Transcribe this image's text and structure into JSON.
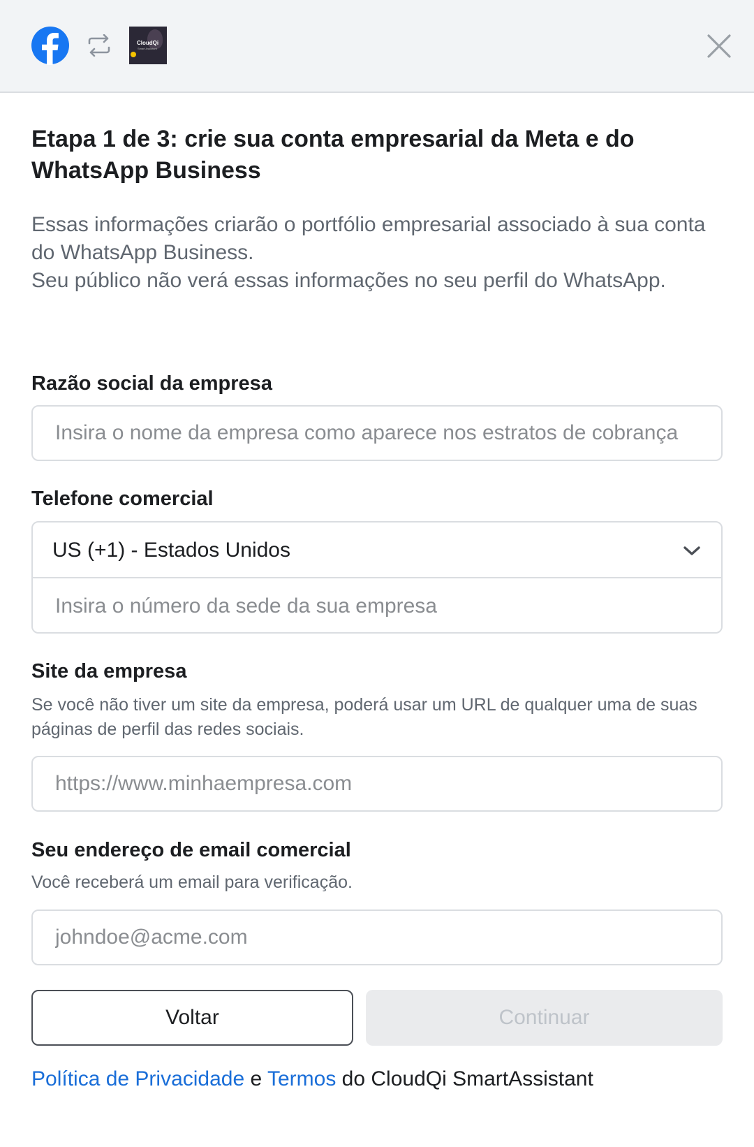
{
  "header": {
    "facebook_logo": "facebook-icon",
    "link_icon": "swap-arrows-icon",
    "app_thumbnail_text": "CloudQi",
    "app_thumbnail_subtext": "Smart Assistant",
    "close_icon": "close-icon"
  },
  "title": "Etapa 1 de 3: crie sua conta empresarial da Meta e do WhatsApp Business",
  "description": {
    "line1": "Essas informações criarão o portfólio empresarial associado à sua conta do WhatsApp Business.",
    "line2": "Seu público não verá essas informações no seu perfil do WhatsApp."
  },
  "business_name": {
    "label": "Razão social da empresa",
    "placeholder": "Insira o nome da empresa como aparece nos estratos de cobrança",
    "value": ""
  },
  "business_phone": {
    "label": "Telefone comercial",
    "country_selected": "US (+1) - Estados Unidos",
    "placeholder": "Insira o número da sede da sua empresa",
    "value": ""
  },
  "website": {
    "label": "Site da empresa",
    "hint": "Se você não tiver um site da empresa, poderá usar um URL de qualquer uma de suas páginas de perfil das redes sociais.",
    "placeholder": "https://www.minhaempresa.com",
    "value": ""
  },
  "email": {
    "label": "Seu endereço de email comercial",
    "hint": "Você receberá um email para verificação.",
    "placeholder": "johndoe@acme.com",
    "value": ""
  },
  "buttons": {
    "back": "Voltar",
    "continue": "Continuar"
  },
  "footer": {
    "privacy_link": "Política de Privacidade",
    "conjunction": " e ",
    "terms_link": "Termos",
    "suffix": " do CloudQi SmartAssistant"
  },
  "colors": {
    "link": "#1a6ed8",
    "facebook_blue": "#1877f2",
    "disabled_button_bg": "#eaebed",
    "disabled_button_text": "#bec3c9"
  }
}
